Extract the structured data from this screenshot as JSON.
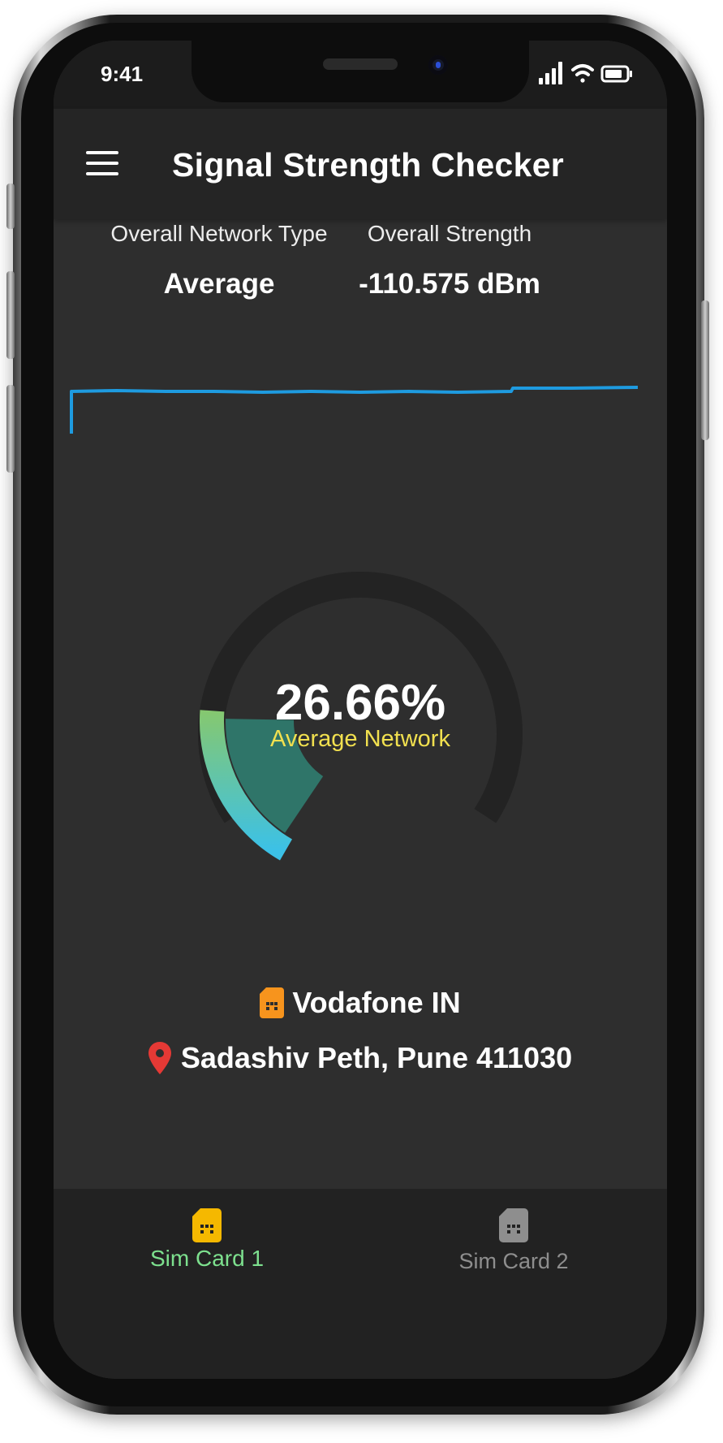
{
  "status_bar": {
    "time": "9:41",
    "icons": [
      "signal-icon",
      "wifi-icon",
      "battery-icon"
    ]
  },
  "app_bar": {
    "title": "Signal Strength Checker",
    "menu_icon": "menu-icon"
  },
  "stats": {
    "network_type": {
      "label": "Overall Network Type",
      "value": "Average"
    },
    "strength": {
      "label": "Overall Strength",
      "value": "-110.575 dBm"
    }
  },
  "gauge": {
    "percent": "26.66%",
    "fraction": 0.2666,
    "caption": "Average Network"
  },
  "operator": {
    "name": "Vodafone IN",
    "icon": "sim-card-icon"
  },
  "location": {
    "text": "Sadashiv Peth, Pune 411030",
    "icon": "location-pin-icon"
  },
  "bottom_nav": {
    "items": [
      {
        "label": "Sim Card 1",
        "active": true
      },
      {
        "label": "Sim Card 2",
        "active": false
      }
    ]
  },
  "colors": {
    "accent_green": "#7de08e",
    "caption_yellow": "#f1e04f",
    "graph_line": "#1e9be0",
    "sim_active": "#f5b800",
    "sim_orange": "#f7941d",
    "pin_red": "#e53935",
    "sim_inactive": "#8e8e8e"
  }
}
